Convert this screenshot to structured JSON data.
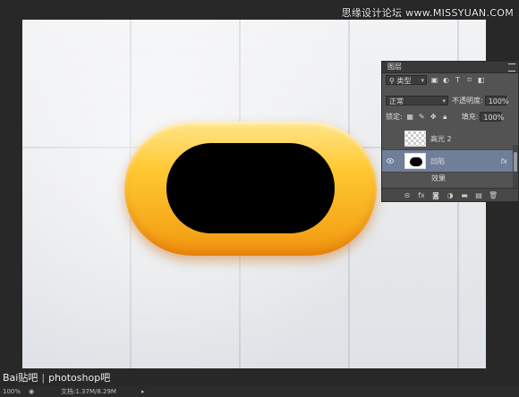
{
  "watermark": "思缘设计论坛 www.MISSYUAN.COM",
  "layers_panel": {
    "tab": "图层",
    "filter_kind": "类型",
    "blend_mode": "正常",
    "opacity_label": "不透明度:",
    "opacity_value": "100%",
    "lock_label": "锁定:",
    "fill_label": "填充:",
    "fill_value": "100%",
    "layers": [
      {
        "name": "高光 2",
        "visible": false
      },
      {
        "name": "凹陷",
        "visible": true,
        "fx": "fx"
      }
    ],
    "effects_label": "效果"
  },
  "logo": {
    "brand": "Bai贴吧",
    "text": "photoshop吧"
  },
  "status": {
    "zoom": "100%",
    "doc": "文档:1.37M/8.29M"
  }
}
